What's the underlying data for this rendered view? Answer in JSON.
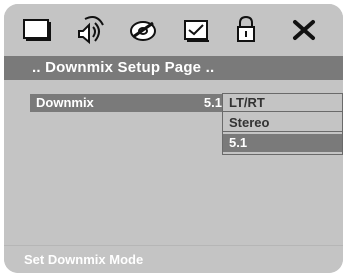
{
  "topbar": {
    "icons": [
      {
        "name": "screen-icon"
      },
      {
        "name": "audio-speaker-icon"
      },
      {
        "name": "disc-icon"
      },
      {
        "name": "checklist-icon"
      },
      {
        "name": "lock-icon"
      },
      {
        "name": "close-icon"
      }
    ]
  },
  "page": {
    "title": ".. Downmix Setup Page .."
  },
  "setting": {
    "label": "Downmix",
    "value": "5.1"
  },
  "options": [
    {
      "label": "LT/RT"
    },
    {
      "label": "Stereo"
    },
    {
      "label": "5.1"
    }
  ],
  "status": {
    "text": "Set Downmix Mode"
  },
  "colors": {
    "panel": "#c4c4c4",
    "header_bar": "#7a7a7a",
    "selected_row": "#7a7a7a",
    "text_light": "#ffffff",
    "text_dark": "#333333"
  }
}
